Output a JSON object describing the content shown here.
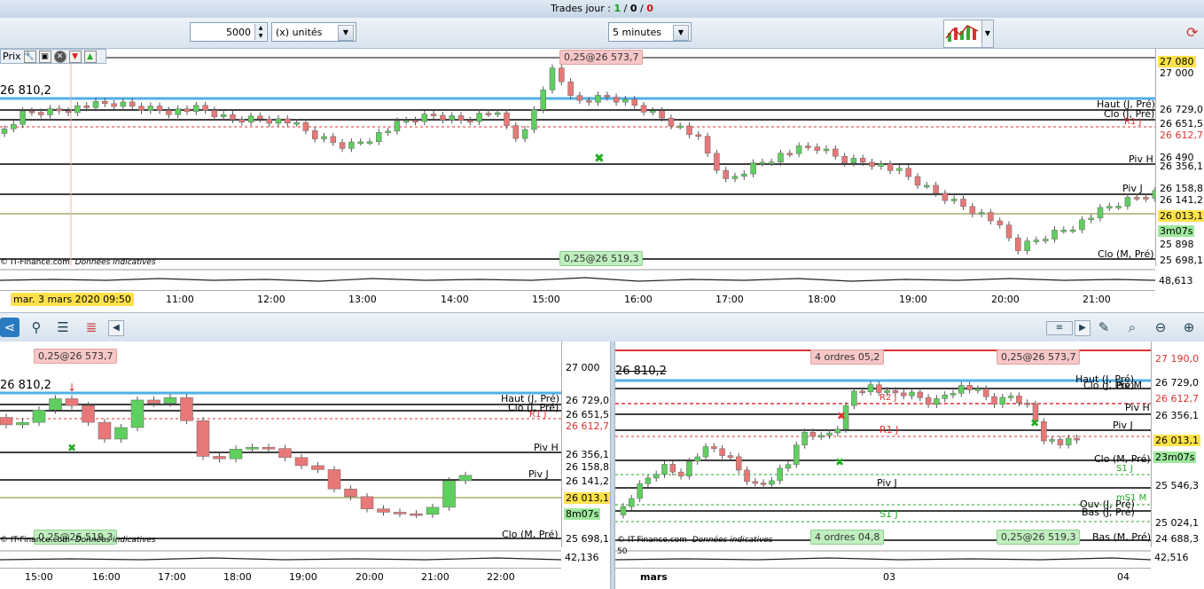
{
  "header": {
    "trades_label": "Trades jour : ",
    "trades_a": "1",
    "trades_sep1": " / ",
    "trades_b": "0",
    "trades_sep2": " / ",
    "trades_c": "0"
  },
  "toolbar": {
    "quantity": "5000",
    "unit": "(x) unités",
    "interval": "5 minutes"
  },
  "colors": {
    "bull": "#5fcf5f",
    "bear": "#e87878",
    "hline_blue": "#4fb0e8",
    "price_tag": "#ffe24a"
  },
  "main_chart": {
    "title": "Prix",
    "last_price_label": "26 810,2",
    "top_order": "0,25@26 573,7",
    "bottom_order": "0,25@26 519,3",
    "watermark": "© IT-Finance.com",
    "watermark_note": "Données indicatives",
    "date_tag": "mar. 3 mars 2020 09:50",
    "price_scale": [
      "27 080",
      "27 000",
      "26 729,0",
      "26 651,5",
      "26 612,7",
      "26 490",
      "26 356,1",
      "26 158,8",
      "26 141,2",
      "26 013,1",
      "3m07s",
      "25 898",
      "25 698,1"
    ],
    "indicator_value": "48,613",
    "level_labels": [
      "Haut (J, Pré)",
      "Clo (J, Pré)",
      "R1 J",
      "Piv H",
      "Piv J",
      "Clo (M, Pré)"
    ],
    "times": [
      "11:00",
      "12:00",
      "13:00",
      "14:00",
      "15:00",
      "16:00",
      "17:00",
      "18:00",
      "19:00",
      "20:00",
      "21:00"
    ]
  },
  "mid_toolbar": {
    "arrow": "◀",
    "scroll": "▶",
    "grip": "≡"
  },
  "left_chart": {
    "last_price_label": "26 810,2",
    "top_order": "0,25@26 573,7",
    "bottom_order": "0,25@26 519,3",
    "watermark": "© IT-Finance.com",
    "watermark_note": "Données indicatives",
    "price_scale": [
      "27 000",
      "26 729,0",
      "26 651,5",
      "26 612,7",
      "26 356,1",
      "26 158,8",
      "26 141,2",
      "26 013,1",
      "8m07s",
      "25 698,1"
    ],
    "indicator_value": "42,136",
    "level_labels": [
      "Haut (J, Pré)",
      "Clo (J, Pré)",
      "R1 J",
      "Piv H",
      "Piv J",
      "Clo (M, Pré)"
    ],
    "times": [
      "15:00",
      "16:00",
      "17:00",
      "18:00",
      "19:00",
      "20:00",
      "21:00",
      "22:00"
    ]
  },
  "right_chart": {
    "last_price_label": "26 810,2",
    "orders_top": "4 ordres",
    "orders_top_price": "05,2",
    "orders_bottom": "4 ordres",
    "orders_bottom_price": "04,8",
    "top_order": "0,25@26 573,7",
    "bottom_order": "0,25@26 519,3",
    "watermark": "© IT-Finance.com",
    "watermark_note": "Données indicatives",
    "price_scale": [
      "27 190,0",
      "26 729,0",
      "26 612,7",
      "26 356,1",
      "26 013,1",
      "23m07s",
      "25 546,3",
      "25 024,1",
      "24 688,3"
    ],
    "indicator_value": "42,516",
    "indicator_left": "50",
    "level_labels": [
      "Haut (J, Pré)",
      "Clo (J, Pré)",
      "Piv M",
      "R2 J",
      "R1 J",
      "Piv H",
      "Piv J",
      "S1 J",
      "Clo (M, Pré)",
      "Piv J",
      "Ouv (J, Pré)",
      "Bas (J, Pré)",
      "S1 J",
      "Bas (M, Pré)",
      "mS1 M"
    ],
    "times": [
      "mars",
      "03",
      "04"
    ]
  }
}
